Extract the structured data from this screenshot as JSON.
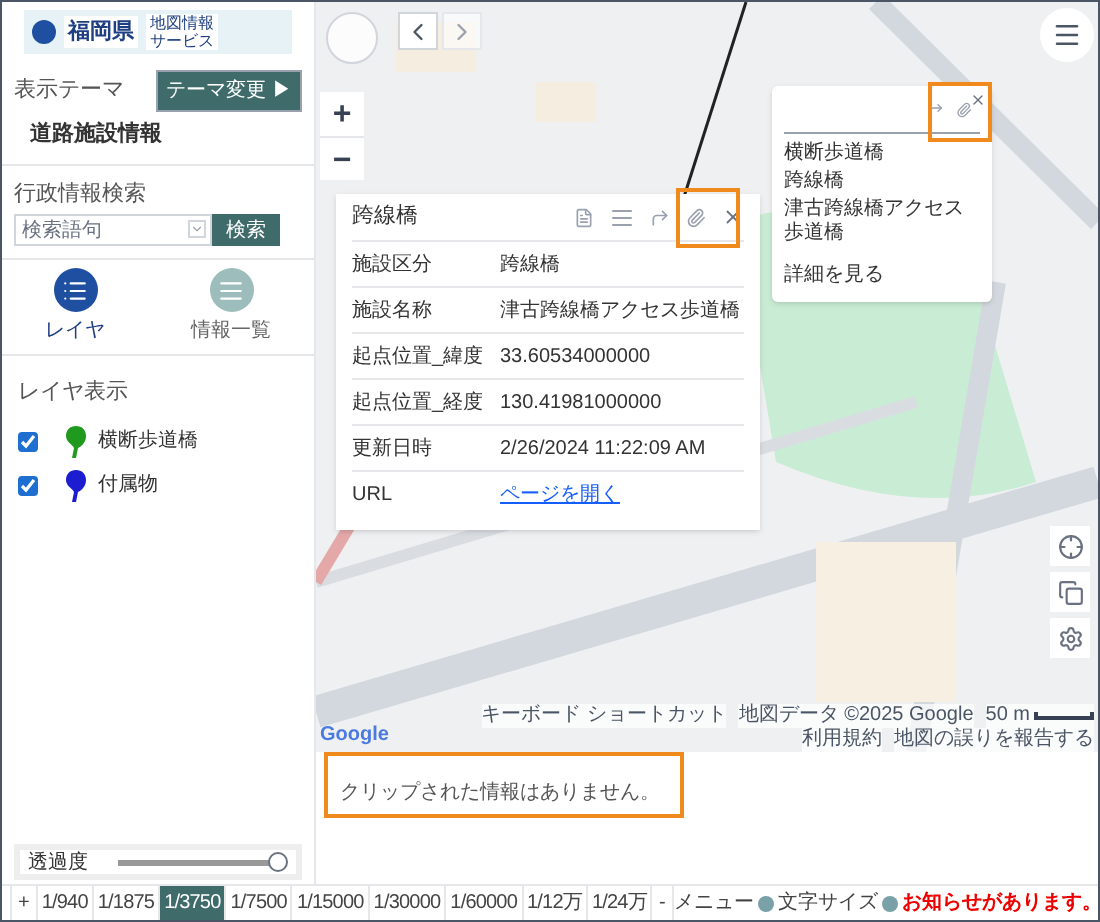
{
  "logo": {
    "name": "福岡県",
    "service_line1": "地図情報",
    "service_line2": "サービス"
  },
  "theme": {
    "label": "表示テーマ",
    "button": "テーマ変更 ▶",
    "name": "道路施設情報"
  },
  "search": {
    "label": "行政情報検索",
    "placeholder": "検索語句",
    "button": "検索"
  },
  "view_tabs": [
    {
      "label": "レイヤ",
      "kind": "layers",
      "selected": true
    },
    {
      "label": "情報一覧",
      "kind": "list",
      "selected": false
    }
  ],
  "layers": {
    "title": "レイヤ表示",
    "items": [
      {
        "label": "横断歩道橋",
        "checked": true,
        "color": "#1f9a1f"
      },
      {
        "label": "付属物",
        "checked": true,
        "color": "#1c1cd0"
      }
    ]
  },
  "opacity": {
    "label": "透過度",
    "level": 1
  },
  "popup": {
    "title": "跨線橋",
    "rows": [
      {
        "label": "施設区分",
        "value": "跨線橋",
        "kind": "text"
      },
      {
        "label": "施設名称",
        "value": "津古跨線橋アクセス歩道橋",
        "kind": "text"
      },
      {
        "label": "起点位置_緯度",
        "value": "33.60534000000",
        "kind": "text"
      },
      {
        "label": "起点位置_経度",
        "value": "130.41981000000",
        "kind": "text"
      },
      {
        "label": "更新日時",
        "value": "2/26/2024 11:22:09 AM",
        "kind": "text"
      },
      {
        "label": "URL",
        "value": "ページを開く",
        "kind": "link"
      }
    ]
  },
  "map_zoom": {
    "zoom_in": "+",
    "zoom_out": "−"
  },
  "mini_popup": {
    "items": [
      "横断歩道橋",
      "跨線橋",
      "津古跨線橋アクセス歩道橋"
    ],
    "link": "詳細を見る"
  },
  "map_footer": {
    "logo": "Google",
    "shortcuts": "キーボード ショートカット",
    "map_data": "地図データ ©2025 Google",
    "scale": "50 m",
    "terms": "利用規約",
    "report": "地図の誤りを報告する"
  },
  "clip": {
    "message": "クリップされた情報はありません。"
  },
  "scale_bar": {
    "zoom_in": "+",
    "zoom_out": "-",
    "scales": [
      {
        "label": "1/940",
        "selected": false
      },
      {
        "label": "1/1875",
        "selected": false
      },
      {
        "label": "1/3750",
        "selected": true
      },
      {
        "label": "1/7500",
        "selected": false
      },
      {
        "label": "1/15000",
        "selected": false
      },
      {
        "label": "1/30000",
        "selected": false
      },
      {
        "label": "1/60000",
        "selected": false
      },
      {
        "label": "1/12万",
        "selected": false
      },
      {
        "label": "1/24万",
        "selected": false
      }
    ]
  },
  "footer": {
    "menu": "メニュー",
    "font_size": "文字サイズ",
    "notice": "お知らせがあります。"
  }
}
